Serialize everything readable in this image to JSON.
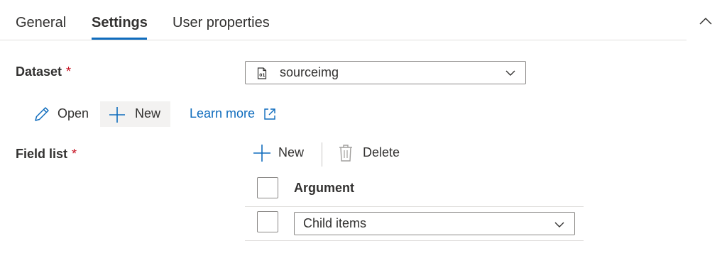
{
  "tabs": {
    "general": "General",
    "settings": "Settings",
    "user_properties": "User properties",
    "active": "settings"
  },
  "dataset": {
    "label": "Dataset",
    "required_mark": "*",
    "value": "sourceimg",
    "icon": "dataset-file-icon",
    "actions": {
      "open": "Open",
      "new": "New",
      "learn_more": "Learn more"
    }
  },
  "field_list": {
    "label": "Field list",
    "required_mark": "*",
    "toolbar": {
      "new": "New",
      "delete": "Delete"
    },
    "column_header": "Argument",
    "rows": [
      {
        "argument": "Child items"
      }
    ]
  },
  "colors": {
    "accent": "#0f6cbd",
    "required": "#c50f1f",
    "text": "#323130",
    "border": "#8a8886"
  }
}
